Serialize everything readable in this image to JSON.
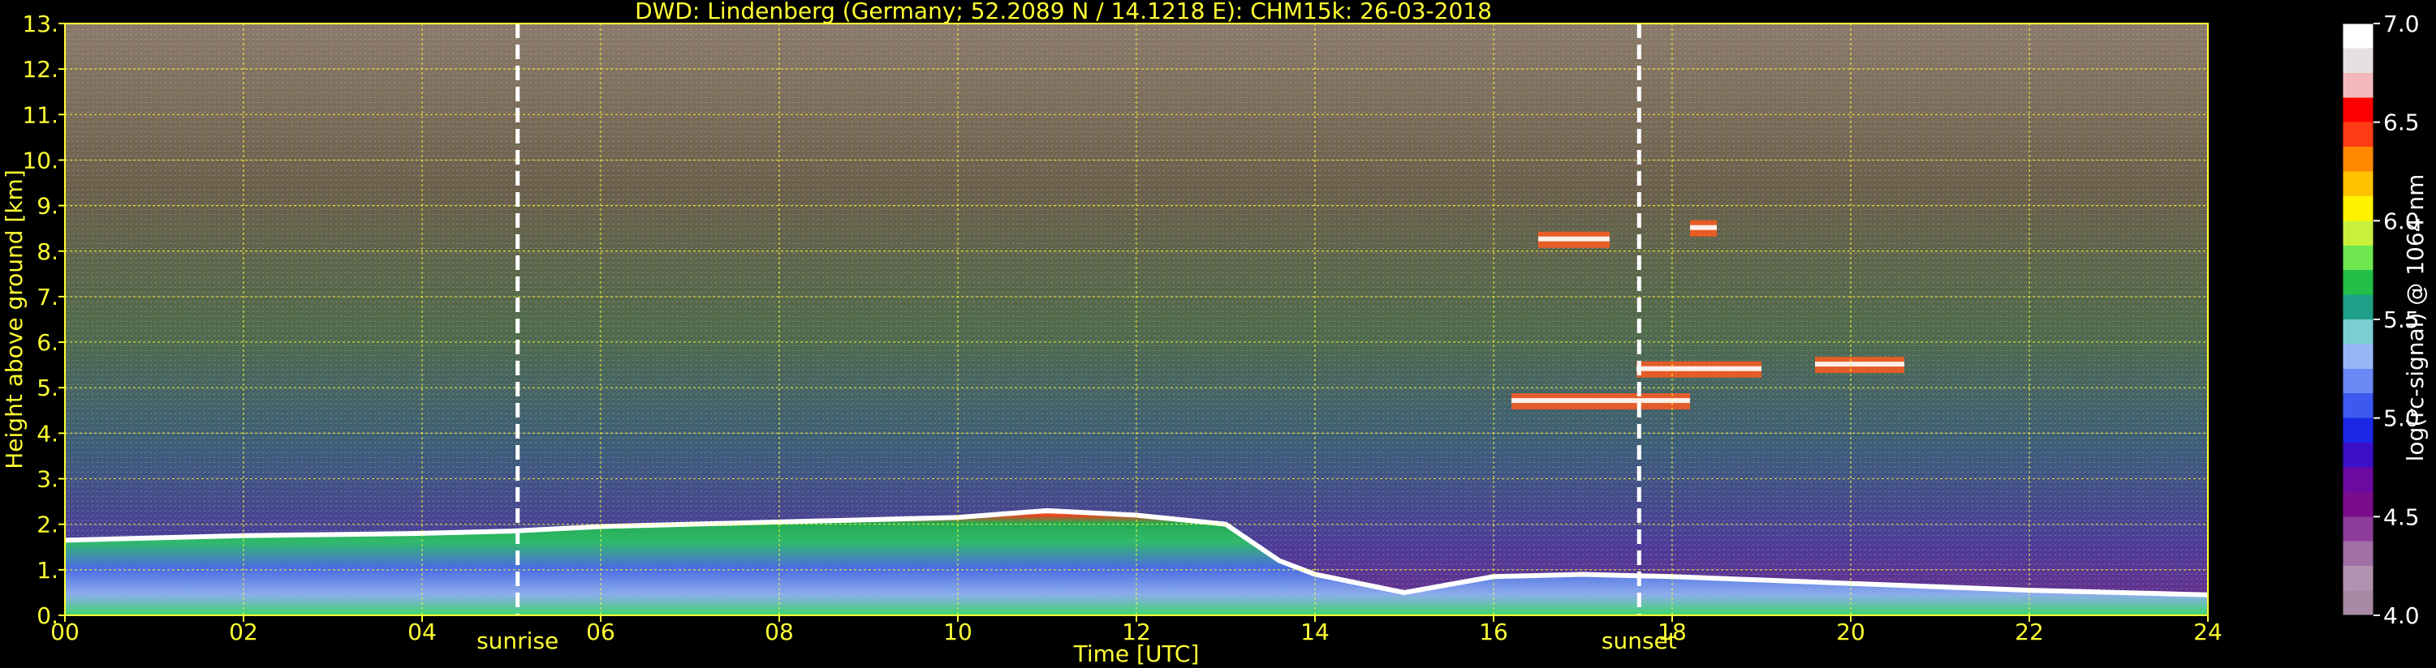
{
  "chart_data": {
    "type": "heatmap",
    "title": "DWD: Lindenberg (Germany; 52.2089 N / 14.1218 E):     CHM15k: 26-03-2018",
    "xlabel": "Time [UTC]",
    "ylabel": "Height above ground [km]",
    "x_range": [
      0,
      24
    ],
    "y_range": [
      0,
      13
    ],
    "x_ticks": [
      "00",
      "02",
      "04",
      "06",
      "08",
      "10",
      "12",
      "14",
      "16",
      "18",
      "20",
      "22",
      "24"
    ],
    "y_ticks": [
      "0.",
      "1.",
      "2.",
      "3.",
      "4.",
      "5.",
      "6.",
      "7.",
      "8.",
      "9.",
      "10.",
      "11.",
      "12.",
      "13."
    ],
    "grid": true,
    "markers": [
      {
        "label": "sunrise",
        "time": 5.07
      },
      {
        "label": "sunset",
        "time": 17.63
      }
    ],
    "colorbar": {
      "label": "log(rc-signal) @ 1064 nm",
      "range": [
        4.0,
        7.0
      ],
      "ticks": [
        "4.0",
        "4.5",
        "5.0",
        "5.5",
        "6.0",
        "6.5",
        "7.0"
      ],
      "colors": [
        "#a88aa4",
        "#b391b0",
        "#a070a4",
        "#8c3c9a",
        "#7a0e8a",
        "#6a0aa0",
        "#3c10c8",
        "#1a28e6",
        "#3c5af0",
        "#6c88f4",
        "#98b6f6",
        "#7ccfd0",
        "#1ea088",
        "#22c046",
        "#6ee64e",
        "#c8f03c",
        "#fff200",
        "#ffc000",
        "#ff8800",
        "#ff3c14",
        "#ff0000",
        "#f4b8bc",
        "#e6e0e0",
        "#ffffff"
      ]
    },
    "boundary_layer_top_km": {
      "time_h": [
        0,
        2,
        4,
        5,
        6,
        8,
        10,
        11,
        12,
        13,
        13.6,
        14,
        15,
        16,
        17,
        18,
        20,
        22,
        24
      ],
      "height_km": [
        1.65,
        1.75,
        1.8,
        1.85,
        1.95,
        2.05,
        2.15,
        2.3,
        2.2,
        2.0,
        1.2,
        0.9,
        0.5,
        0.85,
        0.9,
        0.85,
        0.7,
        0.55,
        0.45
      ]
    },
    "cloud_layers": [
      {
        "t_start": 16.5,
        "t_end": 17.3,
        "height_km": 8.25
      },
      {
        "t_start": 18.2,
        "t_end": 18.5,
        "height_km": 8.5
      },
      {
        "t_start": 17.6,
        "t_end": 19.0,
        "height_km": 5.4
      },
      {
        "t_start": 19.6,
        "t_end": 20.6,
        "height_km": 5.5
      },
      {
        "t_start": 16.2,
        "t_end": 18.2,
        "height_km": 4.7
      }
    ]
  }
}
